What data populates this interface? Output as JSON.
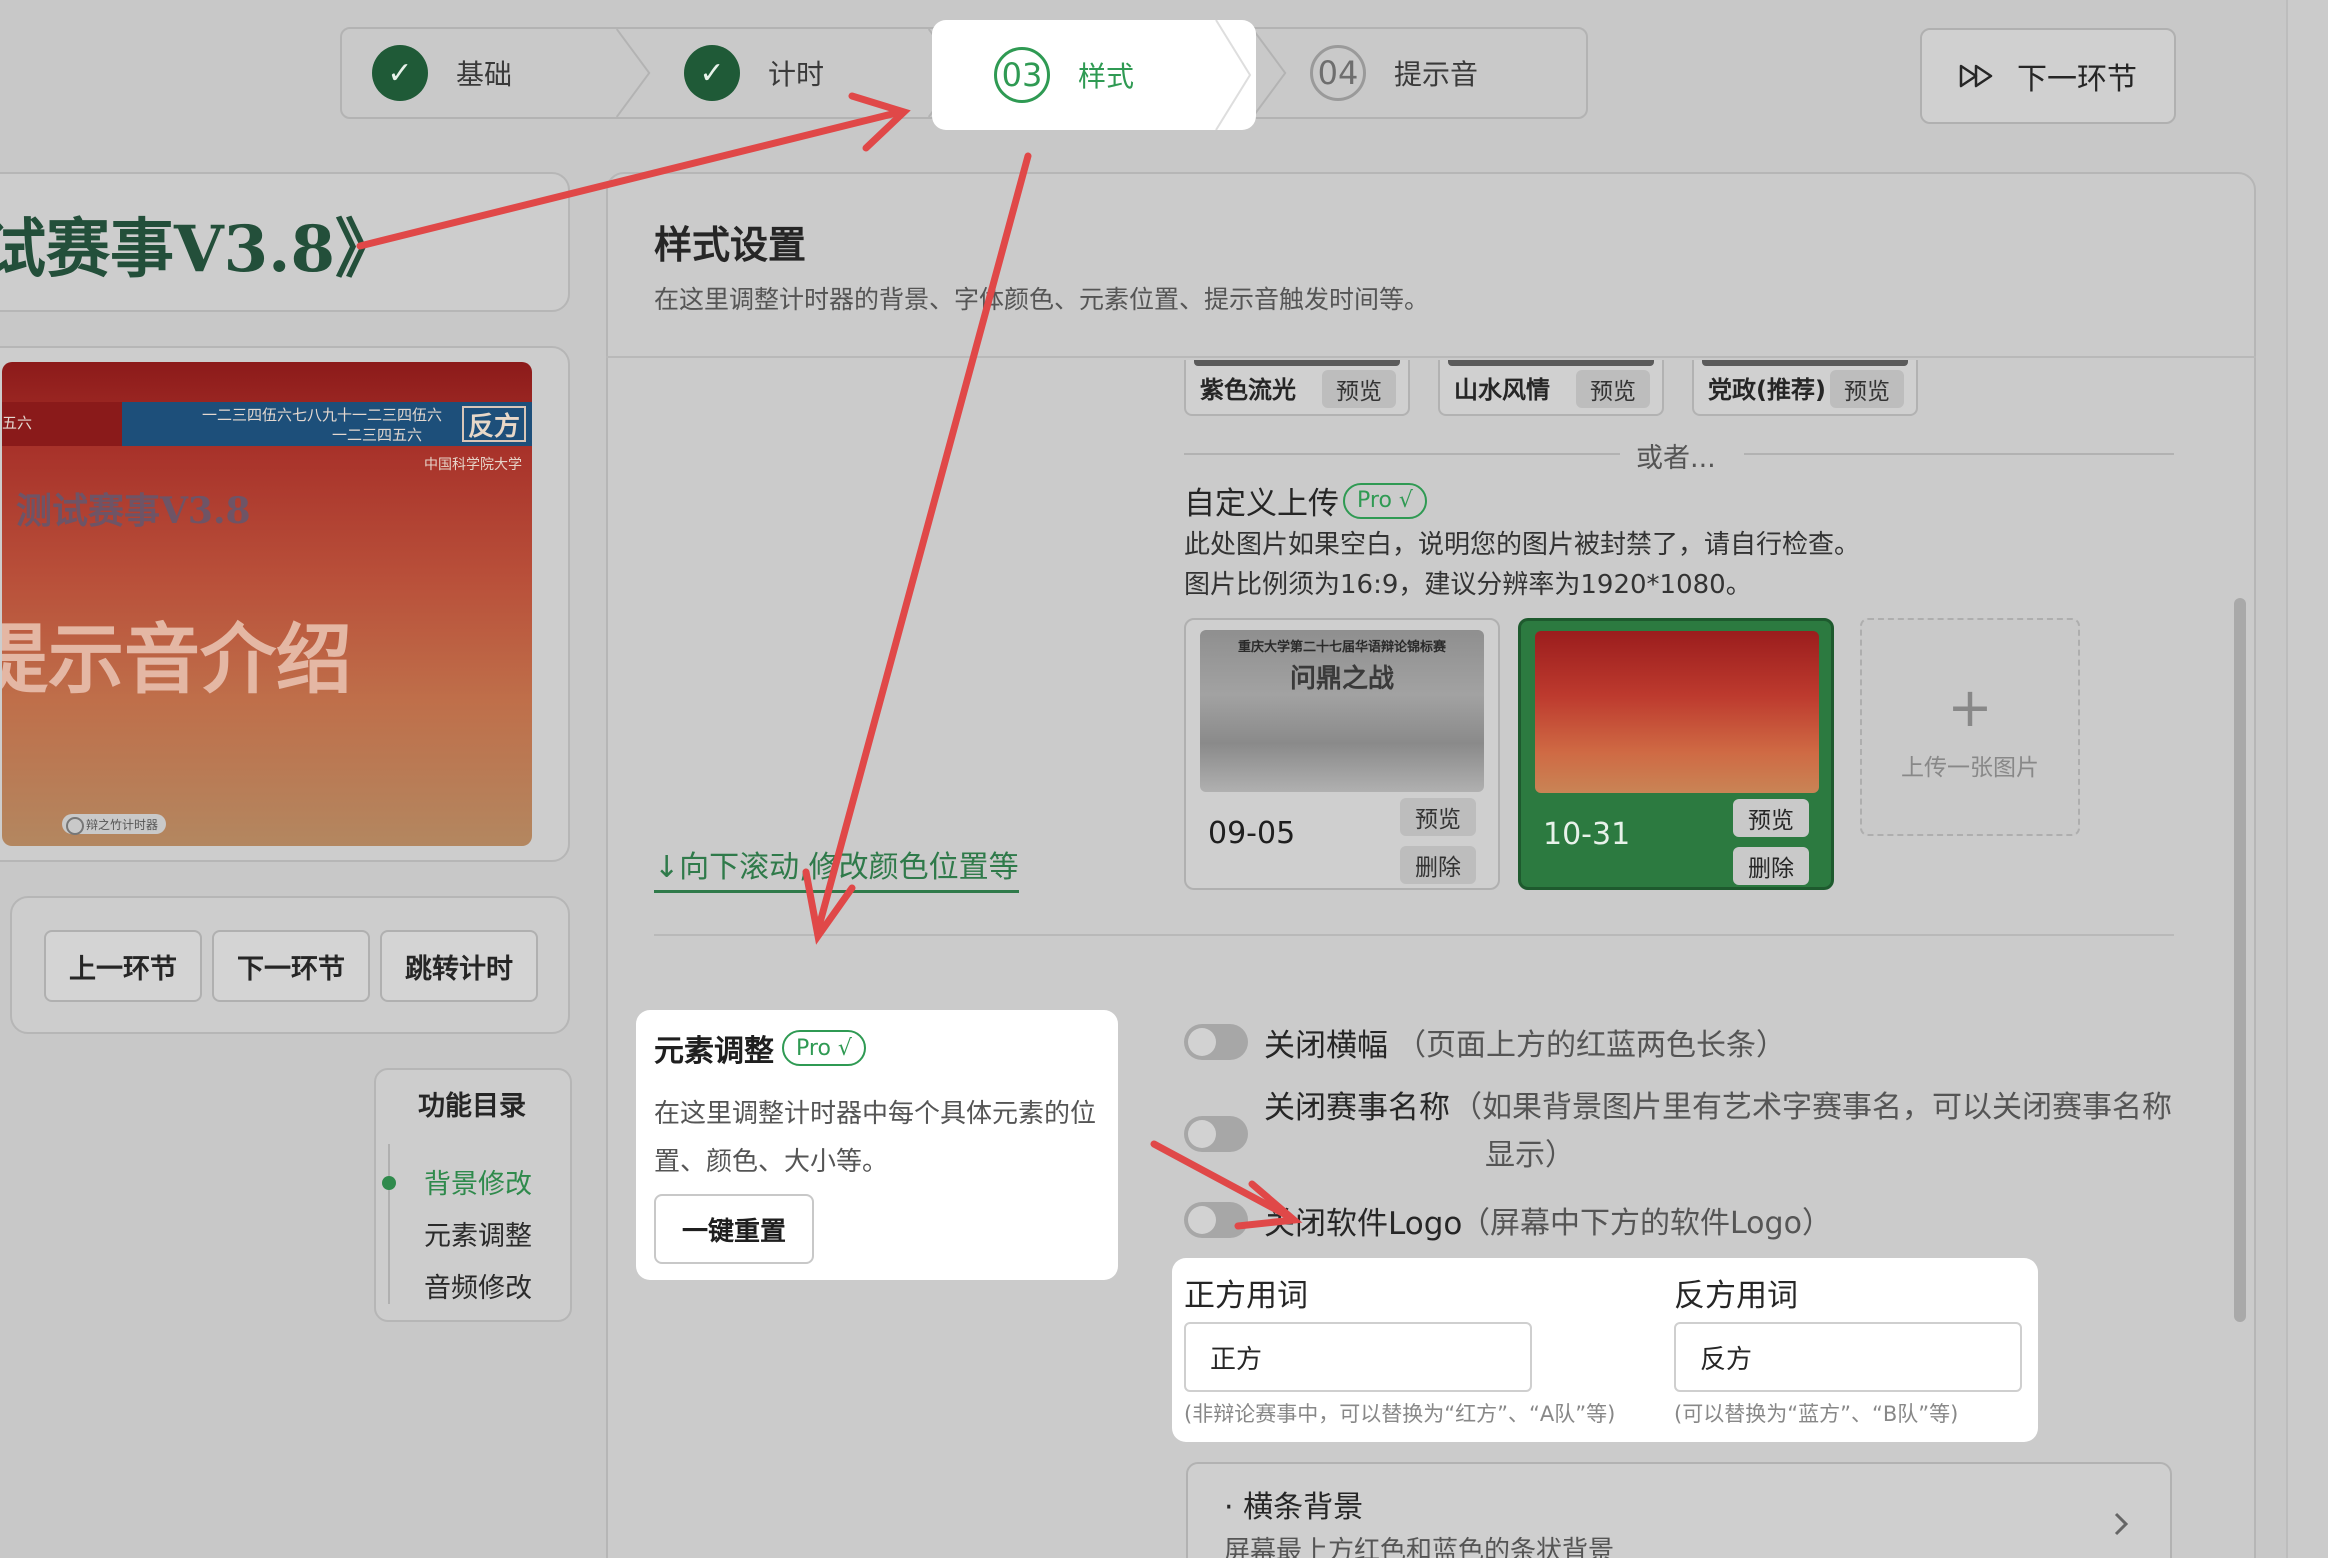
{
  "stepper": {
    "steps": [
      {
        "number": "",
        "label": "基础",
        "state": "done"
      },
      {
        "number": "",
        "label": "计时",
        "state": "done"
      },
      {
        "number": "03",
        "label": "样式",
        "state": "current"
      },
      {
        "number": "04",
        "label": "提示音",
        "state": "todo"
      }
    ],
    "check_glyph": "✓",
    "next_button_label": "下一环节",
    "next_icon": "fast-forward-icon"
  },
  "left": {
    "event_title": "试赛事V3.8》",
    "preview": {
      "band_left_text": "五六",
      "band_line1": "一二三四伍六七八九十一二三四伍六",
      "band_line2": "一二三四五六",
      "side_label": "反方",
      "university": "中国科学院大学",
      "event_name": "测试赛事V3.8",
      "topic": "提示音介绍",
      "logo_text": "辩之竹计时器"
    },
    "controls": [
      "上一环节",
      "下一环节",
      "跳转计时"
    ],
    "toc": {
      "title": "功能目录",
      "items": [
        "背景修改",
        "元素调整",
        "音频修改"
      ],
      "active_index": 0
    }
  },
  "main": {
    "title": "样式设置",
    "subtitle": "在这里调整计时器的背景、字体颜色、元素位置、提示音触发时间等。",
    "bg_presets": [
      {
        "name": "紫色流光",
        "preview": "预览"
      },
      {
        "name": "山水风情",
        "preview": "预览"
      },
      {
        "name": "党政(推荐)",
        "preview": "预览"
      }
    ],
    "or_text": "或者...",
    "custom": {
      "title": "自定义上传",
      "pro": "Pro √",
      "line1": "此处图片如果空白，说明您的图片被封禁了，请自行检查。",
      "line2": "图片比例须为16:9，建议分辨率为1920*1080。",
      "images": [
        {
          "label": "09-05",
          "preview": "预览",
          "delete": "删除",
          "selected": false,
          "thumb_title": "问鼎之战",
          "thumb_header": "重庆大学第二十七届华语辩论锦标赛"
        },
        {
          "label": "10-31",
          "preview": "预览",
          "delete": "删除",
          "selected": true
        }
      ],
      "upload_plus": "+",
      "upload_text": "上传一张图片"
    },
    "scroll_link": "↓向下滚动,修改颜色位置等",
    "elements": {
      "title": "元素调整",
      "pro": "Pro √",
      "desc": "在这里调整计时器中每个具体元素的位置、颜色、大小等。",
      "reset": "一键重置"
    },
    "toggles": [
      {
        "label": "关闭横幅",
        "note": "（页面上方的红蓝两色长条）",
        "on": false
      },
      {
        "label": "关闭赛事名称",
        "note": "（如果背景图片里有艺术字赛事名，可以关闭赛事名称显示）",
        "on": false
      },
      {
        "label": "关闭软件Logo",
        "note": "（屏幕中下方的软件Logo）",
        "on": false
      }
    ],
    "words": {
      "pro_label": "正方用词",
      "pro_value": "正方",
      "pro_hint": "(非辩论赛事中，可以替换为“红方”、“A队”等)",
      "con_label": "反方用词",
      "con_value": "反方",
      "con_hint": "(可以替换为“蓝方”、“B队”等)"
    },
    "bar_section": {
      "title": "· 横条背景",
      "subtitle": "屏幕最上方红色和蓝色的条状背景"
    }
  },
  "colors": {
    "accent": "#2f9a53",
    "annotation_arrow": "#e04848",
    "done_step": "#1f5a37",
    "selected_card": "#2c7a40"
  }
}
